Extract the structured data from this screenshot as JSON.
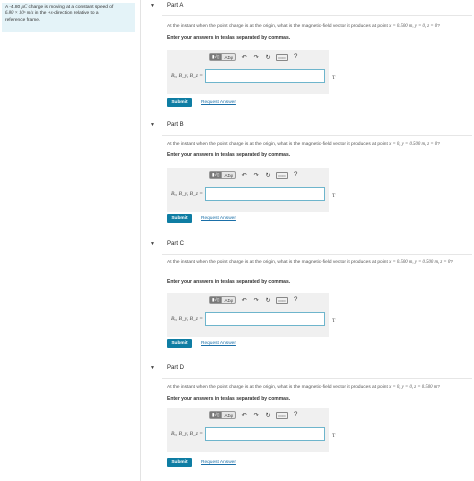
{
  "intro": {
    "line1_a": "A -4.80 ",
    "line1_unit": "μC",
    "line1_b": " charge is moving at a constant speed of",
    "line2_val": "6.80 × 10⁵ m/s",
    "line2_b": " in the +",
    "line2_x": "x",
    "line2_c": "-direction relative to a",
    "line3": "reference frame."
  },
  "toolbar": {
    "templates_label": "▮√▯",
    "greek_label": "ΑΣφ",
    "undo_icon": "↶",
    "redo_icon": "↷",
    "reset_icon": "↻",
    "keyboard_label": "▭▭",
    "help_label": "?"
  },
  "common": {
    "instruction": "Enter your answers in teslas separated by commas.",
    "answer_label": "Bₓ, B_y, B_z =",
    "unit": "T",
    "submit": "Submit",
    "request": "Request Answer"
  },
  "parts": [
    {
      "title": "Part A",
      "q_pre": "At the instant when the point charge is at the origin, what is the magnetic-field vector it produces at point ",
      "q_point": "x = 0.500 m, y = 0, z = 0",
      "q_post": "?"
    },
    {
      "title": "Part B",
      "q_pre": "At the instant when the point charge is at the origin, what is the magnetic-field vector it produces at point ",
      "q_point": "x = 0, y = 0.500 m, z = 0",
      "q_post": "?"
    },
    {
      "title": "Part C",
      "q_pre": "At the instant when the point charge is at the origin, what is the magnetic-field vector it produces at point ",
      "q_point": "x = 0.500 m, y = 0.500 m, z = 0",
      "q_post": "?"
    },
    {
      "title": "Part D",
      "q_pre": "At the instant when the point charge is at the origin, what is the magnetic-field vector it produces at point ",
      "q_point": "x = 0, y = 0, z = 0.500 m",
      "q_post": "?"
    }
  ]
}
